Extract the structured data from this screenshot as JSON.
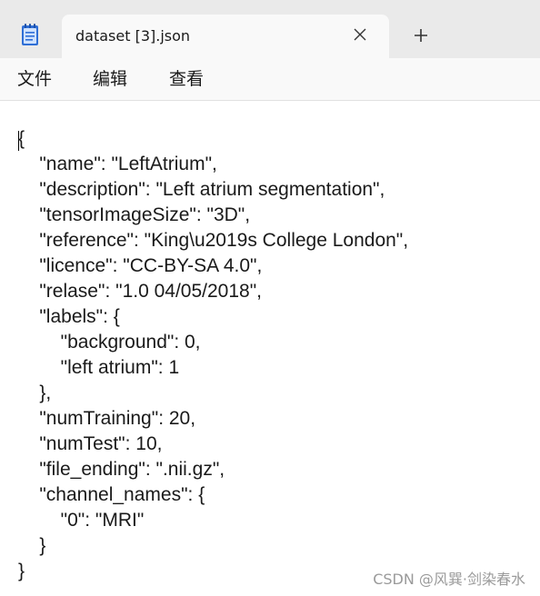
{
  "window": {
    "tab_title": "dataset [3].json",
    "new_tab_symbol": "+",
    "app_icon": "notepad-icon",
    "close_icon": "close-icon"
  },
  "menu": {
    "file": "文件",
    "edit": "编辑",
    "view": "查看"
  },
  "document": {
    "lines": [
      "{",
      "    \"name\": \"LeftAtrium\",",
      "    \"description\": \"Left atrium segmentation\",",
      "    \"tensorImageSize\": \"3D\",",
      "    \"reference\": \"King\\u2019s College London\",",
      "    \"licence\": \"CC-BY-SA 4.0\",",
      "    \"relase\": \"1.0 04/05/2018\",",
      "    \"labels\": {",
      "        \"background\": 0,",
      "        \"left atrium\": 1",
      "    },",
      "    \"numTraining\": 20,",
      "    \"numTest\": 10,",
      "    \"file_ending\": \".nii.gz\",",
      "    \"channel_names\": {",
      "        \"0\": \"MRI\"",
      "    }",
      "}"
    ]
  },
  "watermark": "CSDN @风巽·剑染春水",
  "colors": {
    "titlebar_bg": "#eaeaea",
    "tab_bg": "#f9f9f9",
    "text": "#1a1a1a",
    "watermark": "#9a9a9a",
    "icon_blue": "#2f6fd6"
  }
}
